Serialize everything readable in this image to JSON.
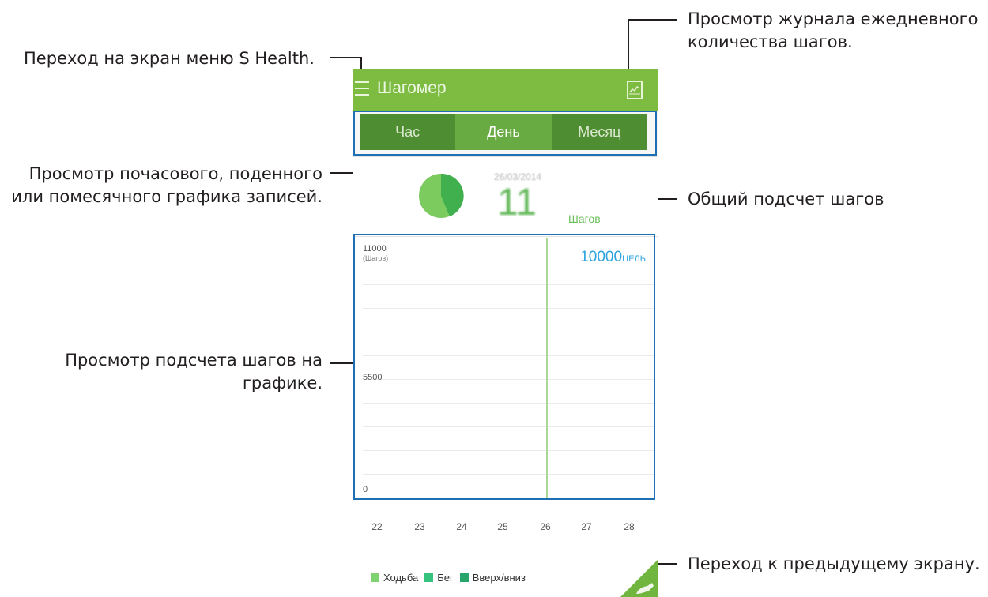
{
  "callouts": {
    "menu": "Переход на экран меню S Health.",
    "log_line1": "Просмотр журнала ежедневного",
    "log_line2": "количества шагов.",
    "tabs_line1": "Просмотр почасового, поденного",
    "tabs_line2": "или помесячного графика записей.",
    "total": "Общий подсчет шагов",
    "graph_line1": "Просмотр подсчета шагов на",
    "graph_line2": "графике.",
    "back": "Переход к предыдущему экрану."
  },
  "app": {
    "title": "Шагомер",
    "icons": {
      "menu": "hamburger-menu-icon",
      "log": "chart-log-icon",
      "back": "shoe-icon"
    },
    "accent": "#7dbb41"
  },
  "tabs": [
    {
      "label": "Час",
      "active": false
    },
    {
      "label": "День",
      "active": true
    },
    {
      "label": "Месяц",
      "active": false
    }
  ],
  "summary": {
    "date": "26/03/2014",
    "steps": "11",
    "unit": "Шагов"
  },
  "chart_data": {
    "type": "bar",
    "categories": [
      "22",
      "23",
      "24",
      "25",
      "26",
      "27",
      "28"
    ],
    "values": [
      0,
      0,
      0,
      0,
      11,
      0,
      0
    ],
    "ylim": [
      0,
      11000
    ],
    "yticks": [
      "11000",
      "5500",
      "0"
    ],
    "ylabel": "(Шагов)",
    "goal": {
      "value": "10000",
      "label": "ЦЕЛЬ"
    },
    "legend": [
      {
        "name": "Ходьба",
        "color": "#7ed26f"
      },
      {
        "name": "Бег",
        "color": "#35c37d"
      },
      {
        "name": "Вверх/вниз",
        "color": "#27a56b"
      }
    ]
  }
}
